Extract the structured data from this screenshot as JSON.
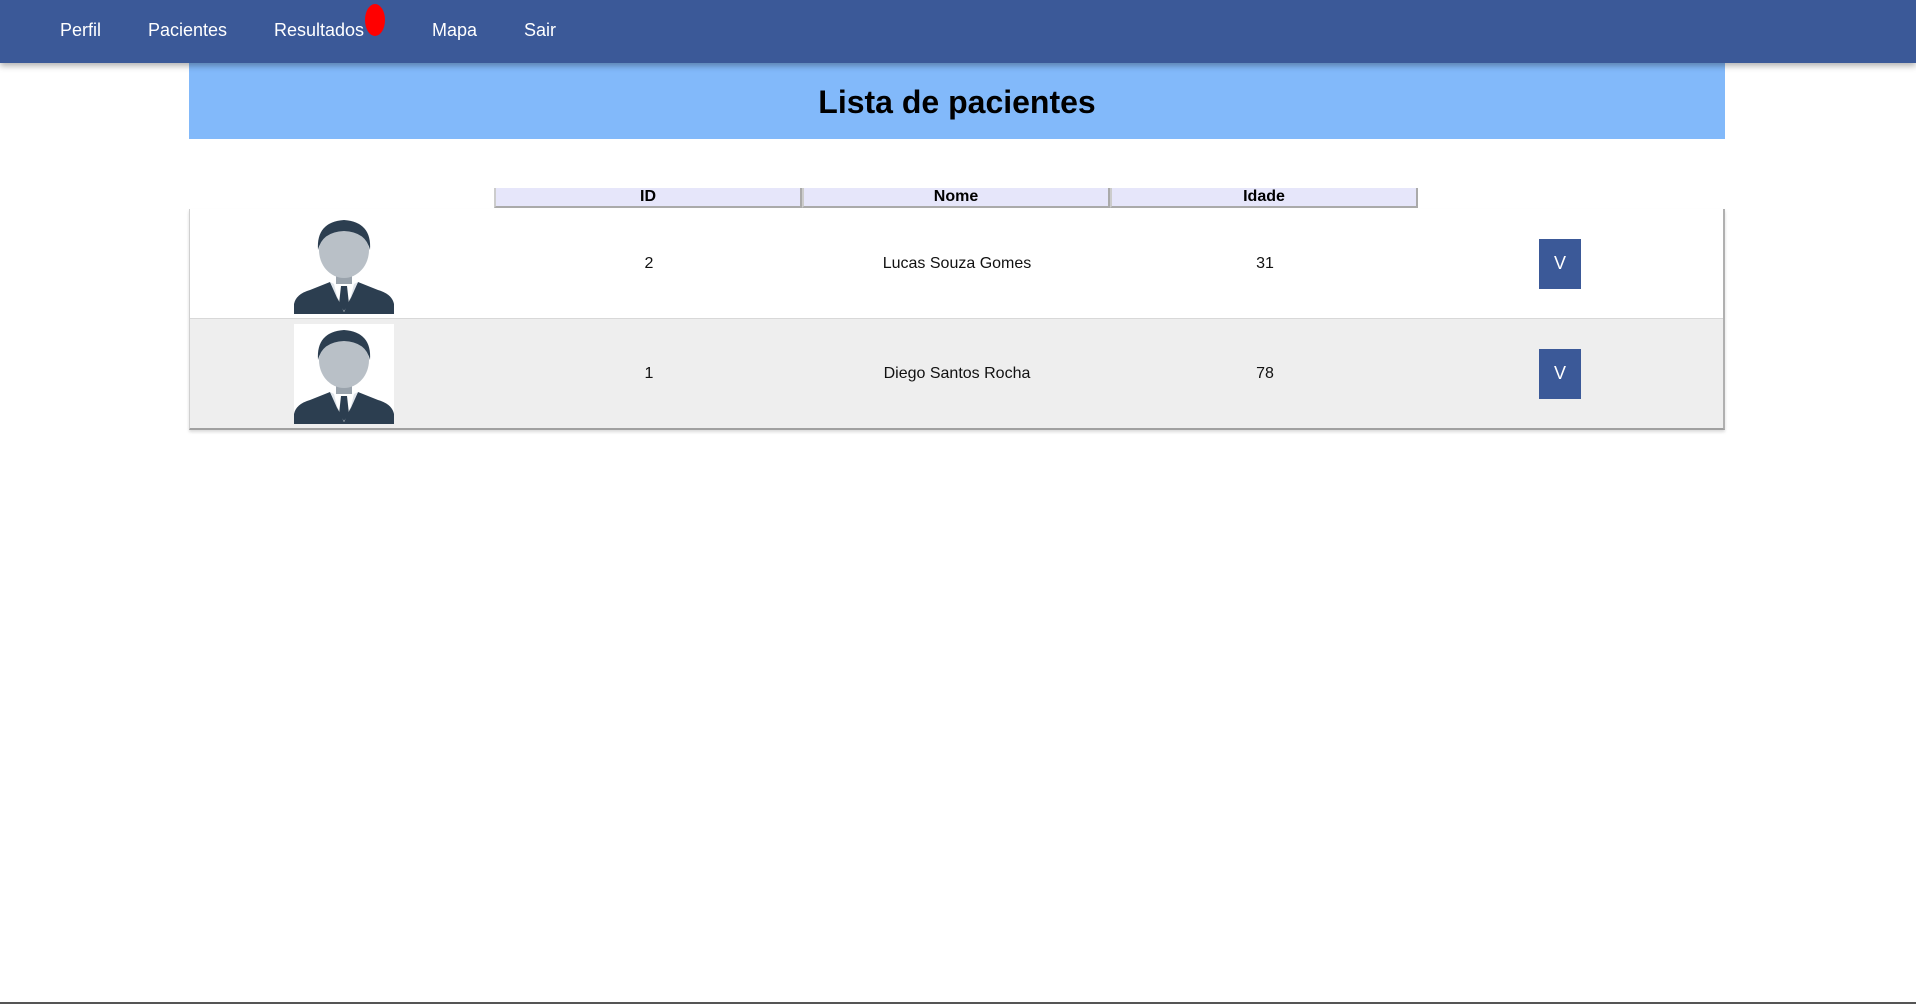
{
  "nav": {
    "items": [
      {
        "label": "Perfil"
      },
      {
        "label": "Pacientes"
      },
      {
        "label": "Resultados"
      },
      {
        "label": "Mapa"
      },
      {
        "label": "Sair"
      }
    ],
    "notification_color": "#ff0000",
    "background_color": "#3b5998"
  },
  "banner": {
    "title": "Lista de pacientes",
    "background_color": "#82b9fa"
  },
  "table": {
    "headers": [
      "ID",
      "Nome",
      "Idade"
    ],
    "rows": [
      {
        "id": "2",
        "nome": "Lucas Souza Gomes",
        "idade": "31",
        "action_label": "V",
        "avatar_icon": "user-avatar-icon"
      },
      {
        "id": "1",
        "nome": "Diego Santos Rocha",
        "idade": "78",
        "action_label": "V",
        "avatar_icon": "user-avatar-icon"
      }
    ]
  }
}
